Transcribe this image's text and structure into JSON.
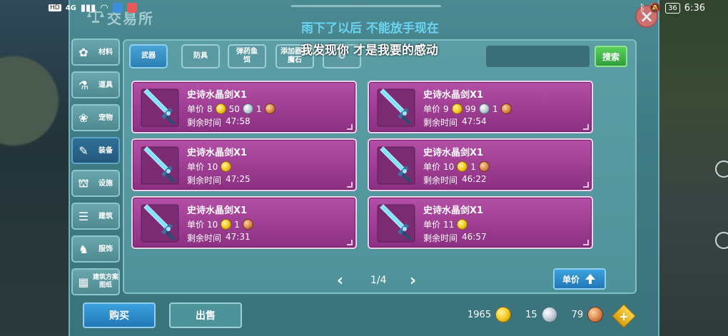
{
  "status_bar": {
    "left_tags": [
      "HD",
      "4G"
    ],
    "battery": "36",
    "time": "6:36"
  },
  "window": {
    "title": "交易所"
  },
  "subtitles": [
    "雨下了以后 不能放手现在",
    "我发现你 才是我要的感动"
  ],
  "sidebar": {
    "items": [
      {
        "label": "材料",
        "icon": "materials-icon",
        "glyph": "✿"
      },
      {
        "label": "道具",
        "icon": "potion-icon",
        "glyph": "⚗"
      },
      {
        "label": "宠物",
        "icon": "paw-icon",
        "glyph": "❀"
      },
      {
        "label": "装备",
        "icon": "equipment-icon",
        "glyph": "✎"
      },
      {
        "label": "设施",
        "icon": "facility-icon",
        "glyph": "⛫"
      },
      {
        "label": "建筑",
        "icon": "building-icon",
        "glyph": "☰"
      },
      {
        "label": "服饰",
        "icon": "clothing-icon",
        "glyph": "♞"
      },
      {
        "label": "建筑方案图纸",
        "icon": "blueprint-icon",
        "glyph": "▦"
      }
    ],
    "active_index": 3
  },
  "tabs": [
    {
      "label": "武器"
    },
    {
      "label": "防具"
    },
    {
      "label": "弹药鱼饵"
    },
    {
      "label": "添加器附魔石"
    },
    {
      "label": "心"
    }
  ],
  "active_tab": 0,
  "search": {
    "placeholder": "",
    "button_label": "搜索"
  },
  "listing_labels": {
    "price": "单价",
    "time": "剩余时间"
  },
  "listings": [
    {
      "name": "史诗水晶剑X1",
      "gold": "8",
      "silver": "50",
      "copper": "1",
      "time": "47:58"
    },
    {
      "name": "史诗水晶剑X1",
      "gold": "9",
      "silver": "99",
      "copper": "1",
      "time": "47:54"
    },
    {
      "name": "史诗水晶剑X1",
      "gold": "10",
      "silver": null,
      "copper": null,
      "time": "47:25"
    },
    {
      "name": "史诗水晶剑X1",
      "gold": "10",
      "silver": null,
      "copper": "1",
      "time": "46:22"
    },
    {
      "name": "史诗水晶剑X1",
      "gold": "10",
      "silver": null,
      "copper": "1",
      "time": "47:31"
    },
    {
      "name": "史诗水晶剑X1",
      "gold": "11",
      "silver": null,
      "copper": null,
      "time": "46:57"
    }
  ],
  "pagination": {
    "label": "1/4",
    "prev": "‹",
    "next": "›"
  },
  "sort": {
    "label": "单价"
  },
  "bottom": {
    "buy_label": "购买",
    "sell_label": "出售",
    "wallet": {
      "gold": "1965",
      "silver": "15",
      "copper": "79"
    },
    "add_label": "+"
  },
  "colors": {
    "panel": "#4c8a93",
    "card": "#b34fa6",
    "active_tab": "#2d7fb4",
    "search_button": "#2f9f3a"
  }
}
